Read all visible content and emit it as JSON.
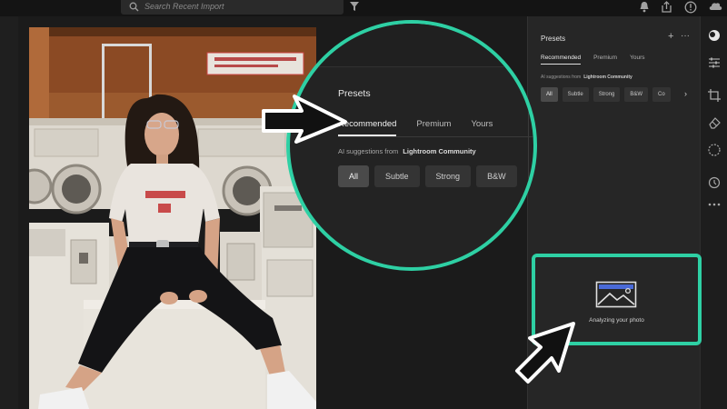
{
  "topbar": {
    "search_placeholder": "Search Recent Import"
  },
  "panel": {
    "title": "Presets",
    "plus": "+",
    "more": "···",
    "tabs": [
      "Recommended",
      "Premium",
      "Yours"
    ],
    "ai_prefix": "AI suggestions from",
    "ai_source": "Lightroom Community",
    "chips": [
      "All",
      "Subtle",
      "Strong",
      "B&W",
      "Co"
    ],
    "next": "›"
  },
  "zoom": {
    "title": "Presets",
    "tabs": [
      "Recommended",
      "Premium",
      "Yours"
    ],
    "ai_prefix": "AI suggestions from",
    "ai_source": "Lightroom Community",
    "chips": [
      "All",
      "Subtle",
      "Strong",
      "B&W"
    ]
  },
  "analyze": {
    "text": "Analyzing your photo"
  },
  "colors": {
    "highlight": "#2ed0a4",
    "panel": "#262626",
    "background": "#1b1b1b"
  },
  "icons": [
    "search-icon",
    "filter-icon",
    "bell-icon",
    "share-icon",
    "help-icon",
    "cloud-icon",
    "presets-icon",
    "sliders-icon",
    "crop-icon",
    "eraser-icon",
    "masking-icon",
    "history-icon",
    "more-icon",
    "image-icon",
    "cursor-icon"
  ]
}
